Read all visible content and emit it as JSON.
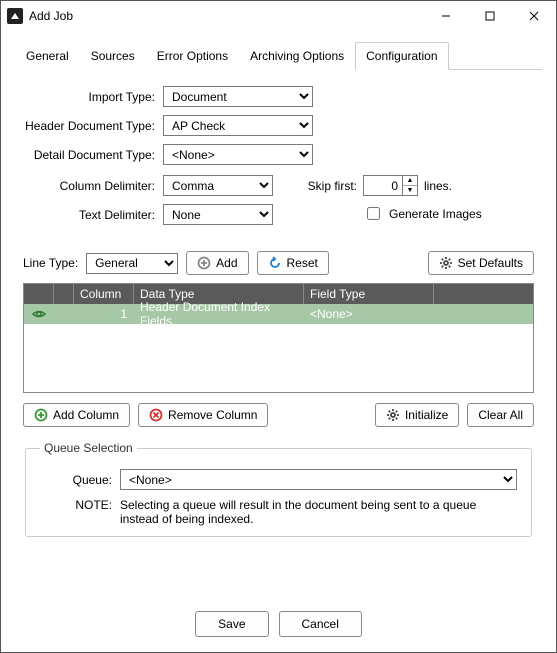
{
  "window": {
    "title": "Add Job"
  },
  "tabs": {
    "general": "General",
    "sources": "Sources",
    "error_options": "Error Options",
    "archiving_options": "Archiving Options",
    "configuration": "Configuration"
  },
  "form": {
    "import_type": {
      "label": "Import Type:",
      "value": "Document"
    },
    "header_doc_type": {
      "label": "Header Document Type:",
      "value": "AP Check"
    },
    "detail_doc_type": {
      "label": "Detail Document Type:",
      "value": "<None>"
    },
    "column_delim": {
      "label": "Column Delimiter:",
      "value": "Comma"
    },
    "text_delim": {
      "label": "Text Delimiter:",
      "value": "None"
    },
    "skip_first": {
      "label": "Skip first:",
      "value": "0",
      "suffix": "lines."
    },
    "generate_images": {
      "label": "Generate Images"
    }
  },
  "line_type": {
    "label": "Line Type:",
    "value": "General",
    "add": "Add",
    "reset": "Reset",
    "set_defaults": "Set Defaults"
  },
  "grid": {
    "headers": {
      "column": "Column",
      "data_type": "Data Type",
      "field_type": "Field Type"
    },
    "rows": [
      {
        "column": "1",
        "data_type": "Header Document Index Fields",
        "field_type": "<None>"
      }
    ]
  },
  "col_buttons": {
    "add_column": "Add Column",
    "remove_column": "Remove Column",
    "initialize": "Initialize",
    "clear_all": "Clear All"
  },
  "queue": {
    "legend": "Queue Selection",
    "label": "Queue:",
    "value": "<None>",
    "note_label": "NOTE:",
    "note_text": "Selecting a queue will result in the document being sent to a queue instead of being indexed."
  },
  "footer": {
    "save": "Save",
    "cancel": "Cancel"
  }
}
